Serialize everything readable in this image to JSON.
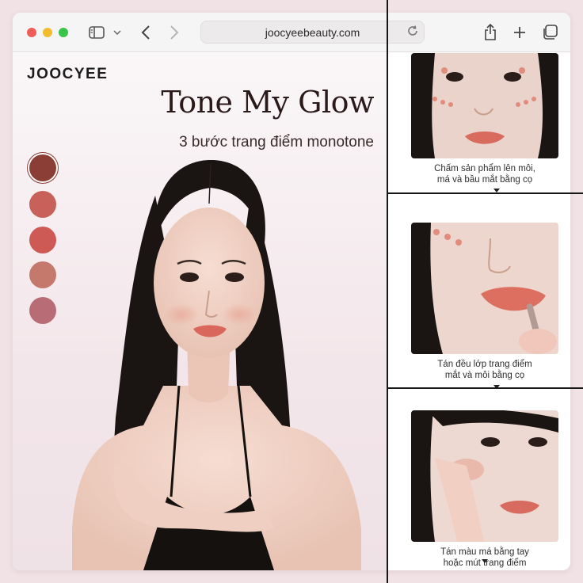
{
  "browser": {
    "url": "joocyeebeauty.com",
    "icons": [
      "sidebar-icon",
      "chevron-down-icon",
      "back-arrow-icon",
      "forward-arrow-icon",
      "reload-icon",
      "share-icon",
      "plus-icon",
      "tabs-icon"
    ]
  },
  "page": {
    "brand": "JOOCYEE",
    "headline": "Tone My Glow",
    "subtitle": "3 bước trang điểm monotone",
    "swatches": [
      {
        "color": "#8b3e35",
        "selected": true
      },
      {
        "color": "#c8615a"
      },
      {
        "color": "#cd5a55"
      },
      {
        "color": "#c5786c"
      },
      {
        "color": "#b86d76"
      }
    ],
    "steps": [
      {
        "caption_line1": "Chấm sản phẩm lên môi,",
        "caption_line2": "má và bầu mắt bằng cọ"
      },
      {
        "caption_line1": "Tán đều lớp trang điểm",
        "caption_line2": "mắt và môi bằng cọ"
      },
      {
        "caption_line1": "Tán màu má bằng tay",
        "caption_line2": "hoặc mút trang điểm"
      }
    ]
  },
  "colors": {
    "page_bg": "#f1e2e6",
    "accent": "#8b3e35",
    "text": "#1c1c1c"
  }
}
